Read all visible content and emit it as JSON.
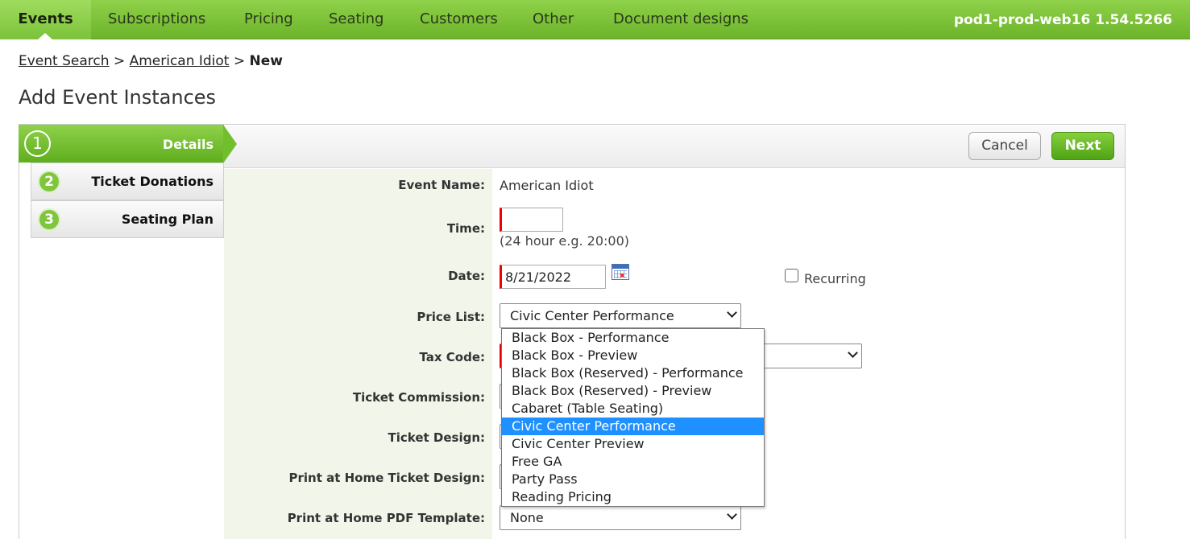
{
  "nav": {
    "items": [
      "Events",
      "Subscriptions",
      "Pricing",
      "Seating",
      "Customers",
      "Other",
      "Document designs"
    ],
    "active": "Events",
    "server_version": "pod1-prod-web16 1.54.5266"
  },
  "breadcrumb": {
    "event_search": "Event Search",
    "event": "American Idiot",
    "current": "New",
    "sep": ">"
  },
  "page_title": "Add Event Instances",
  "steps": [
    {
      "num": "1",
      "label": "Details",
      "active": true
    },
    {
      "num": "2",
      "label": "Ticket Donations",
      "active": false
    },
    {
      "num": "3",
      "label": "Seating Plan",
      "active": false
    }
  ],
  "buttons": {
    "cancel": "Cancel",
    "next": "Next"
  },
  "form": {
    "event_name_label": "Event Name:",
    "event_name_value": "American Idiot",
    "time_label": "Time:",
    "time_value": "",
    "time_hint": "(24 hour e.g. 20:00)",
    "date_label": "Date:",
    "date_value": "8/21/2022",
    "recurring_label": "Recurring",
    "recurring_checked": false,
    "price_list_label": "Price List:",
    "price_list_value": "Civic Center Performance",
    "tax_code_label": "Tax Code:",
    "ticket_commission_label": "Ticket Commission:",
    "ticket_design_label": "Ticket Design:",
    "print_home_design_label": "Print at Home Ticket Design:",
    "print_home_pdf_label": "Print at Home PDF Template:",
    "print_home_pdf_value": "None"
  },
  "price_list_options": [
    "Black Box - Performance",
    "Black Box - Preview",
    "Black Box (Reserved) - Performance",
    "Black Box (Reserved) - Preview",
    "Cabaret (Table Seating)",
    "Civic Center Performance",
    "Civic Center Preview",
    "Free GA",
    "Party Pass",
    "Reading Pricing"
  ],
  "price_list_selected_index": 5,
  "colors": {
    "brand_green": "#6cb42a",
    "required_marker": "#e00000",
    "selection_blue": "#1e90ff"
  }
}
